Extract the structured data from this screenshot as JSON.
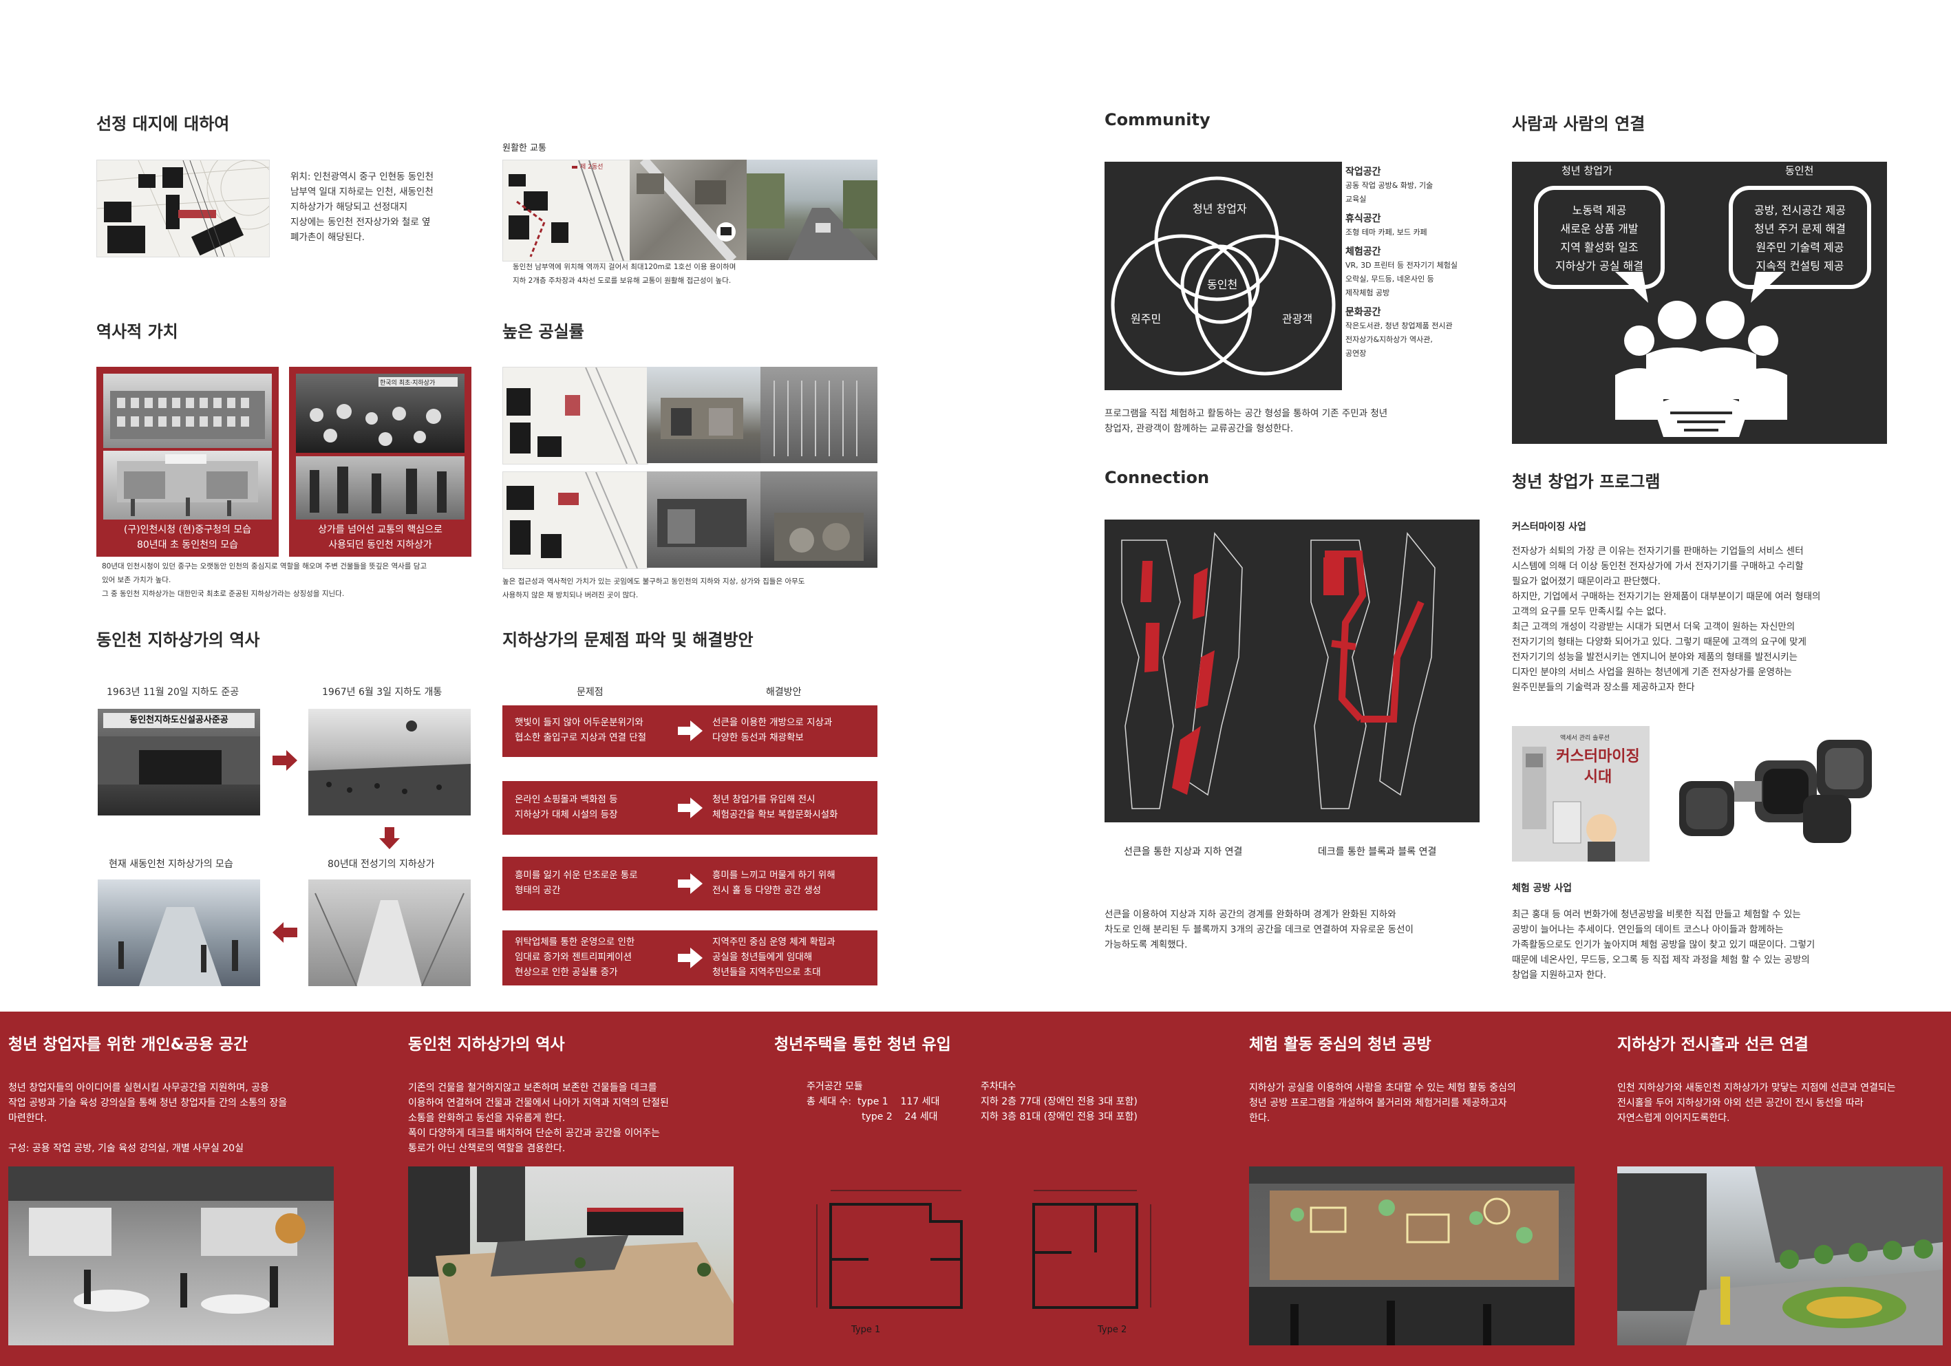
{
  "left": {
    "site": {
      "title": "선정 대지에 대하여",
      "text": "위치: 인천광역시 중구 인현동 동인천\n남부역 일대 지하로는 인천, 새동인천\n지하상가가 해당되고 선정대지\n지상에는 동인천 전자상가와 철로 옆\n폐가촌이 해당된다."
    },
    "traffic": {
      "label": "원활한 교통",
      "legend": "제 2동선",
      "text": "동인천 남부역에 위치해 역까지 걸어서 최대120m로 1호선 이용 용이하며\n지하 2개층 주차장과 4차선 도로를 보유해 교통이 원활해 접근성이 높다."
    },
    "history_value": {
      "title": "역사적 가치",
      "caption_left": "(구)인천시청 (현)중구청의 모습\n80년대 초 동인천의 모습",
      "caption_right": "상가를 넘어선 교통의 핵심으로\n사용되던 동인천 지하상가",
      "photo_sign": "한국의 최초·지하상가",
      "text": "80년대 인천시청이 있던 중구는 오랫동안 인천의 중심지로 역할을 해오며 주변 건물들을 뜻깊은 역사를 담고\n있어 보존 가치가 높다.\n그 중 동인천 지하상가는 대한민국 최초로 준공된 지하상가라는 상징성을 지닌다."
    },
    "vacancy": {
      "title": "높은 공실률",
      "text": "높은 접근성과 역사적인 가치가 있는 곳임에도 불구하고 동인천의 지하와 지상, 상가와 집들은 아무도\n사용하지 않은 채 방치되나 버려진 곳이 많다."
    },
    "mall_history": {
      "title": "동인천 지하상가의 역사",
      "labels": [
        "1963년 11월 20일 지하도 준공",
        "1967년 6월 3일 지하도 개통",
        "현재 새동인천 지하상가의 모습",
        "80년대 전성기의 지하상가"
      ],
      "photo_sign": "동인천지하도신설공사준공"
    },
    "problems": {
      "title": "지하상가의 문제점 파악 및 해결방안",
      "col_problem": "문제점",
      "col_solution": "해결방안",
      "rows": [
        {
          "problem": "햇빛이 들지 않아 어두운분위기와\n협소한 출입구로 지상과 연결 단절",
          "solution": "선큰을 이용한 개방으로 지상과\n다양한 동선과 채광확보"
        },
        {
          "problem": "온라인 쇼핑몰과 백화점 등\n지하상가 대체 시설의 등장",
          "solution": "청년 창업가를 유입해 전시\n체험공간을 확보 복합문화시설화"
        },
        {
          "problem": "흥미를 잃기 쉬운 단조로운 통로\n형태의 공간",
          "solution": "흥미를 느끼고 머물게 하기 위해\n전시 홀 등 다양한 공간 생성"
        },
        {
          "problem": "위탁업체를 통한 운영으로 인한\n임대료 증가와 젠트리피케이션\n현상으로 인한 공실률 증가",
          "solution": "지역주민 중심 운영 체계 확립과\n공실을 청년들에게 임대해\n청년들을 지역주민으로 초대"
        }
      ]
    }
  },
  "right": {
    "community": {
      "title": "Community",
      "circles": [
        "청년 창업자",
        "동인천",
        "원주민",
        "관광객"
      ],
      "spaces": [
        {
          "name": "작업공간",
          "desc": "공동 작업 공방& 화방, 기술\n교육실"
        },
        {
          "name": "휴식공간",
          "desc": "조형 테마 카페, 보드 카페"
        },
        {
          "name": "체험공간",
          "desc": "VR, 3D 프린터 등 전자기기 체험실\n오락실, 무드등, 네온사인 등\n제작체험 공방"
        },
        {
          "name": "문화공간",
          "desc": "작은도서관, 청년 창업제품 전시관\n전자상가&지하상가 역사관,\n공연장"
        }
      ],
      "text": "프로그램을 직접 체험하고 활동하는 공간 형성을 통하여 기존 주민과 청년\n창업자, 관광객이 함께하는 교류공간을 형성한다."
    },
    "people": {
      "title": "사람과 사람의 연결",
      "left_head": "청년 창업가",
      "right_head": "동인천",
      "left_bubble": "노동력 제공\n새로운 상품 개발\n지역 활성화 일조\n지하상가 공실 해결",
      "right_bubble": "공방, 전시공간 제공\n청년 주거 문제 해결\n원주민 기술력 제공\n지속적 컨설팅 제공"
    },
    "connection": {
      "title": "Connection",
      "caption_left": "선큰을 통한 지상과 지하 연결",
      "caption_right": "데크를 통한 블록과 블록 연결",
      "text": "선큰을 이용하여 지상과 지하 공간의 경계를 완화하며 경계가 완화된 지하와\n차도로 인해 분리된 두 블록까지 3개의 공간을 데크로 연결하여 자유로운 동선이\n가능하도록 계획했다."
    },
    "program": {
      "title": "청년 창업가 프로그램",
      "sub1": "커스터마이징 사업",
      "text1": "전자상가 쇠퇴의 가장 큰 이유는 전자기기를 판매하는 기업들의 서비스 센터\n시스템에 의해 더 이상 동인천 전자상가에 가서 전자기기를 구매하고 수리할\n필요가 없어졌기 때문이라고 판단했다.\n하지만, 기업에서 구매하는 전자기기는 완제품이 대부분이기 때문에 여러 형태의\n고객의 요구를 모두 만족시킬 수는 없다.\n최근 고객의 개성이 각광받는 시대가 되면서 더욱 고객이 원하는 자신만의\n전자기기의 형태는 다양화 되어가고 있다. 그렇기 때문에 고객의 요구에 맞게\n전자기기의 성능을 발전시키는 엔지니어 분야와 제품의 형태를 발전시키는\n디자인 분야의 서비스 사업을 원하는 청년에게 기존 전자상가를 운영하는\n원주민분들의 기술력과 장소를 제공하고자 한다",
      "poster_small": "액세서 관리 솔루션",
      "poster_big": "커스터마이징\n시대",
      "sub2": "체험 공방 사업",
      "text2": "최근 홍대 등 여러 번화가에 청년공방을 비롯한 직접 만들고 체험할 수 있는\n공방이 늘어나는 추세이다. 연인들의 데이트 코스나 아이들과 함께하는\n가족활동으로도 인기가 높아지며 체험 공방을 많이 찾고 있기 때문이다. 그렇기\n때문에 네온사인, 무드등, 오그록 등 직접 제작 과정을 체험 할 수 있는 공방의\n창업을 지원하고자 한다."
    }
  },
  "bottom": [
    {
      "title": "청년 창업자를 위한 개인&공용 공간",
      "text": "청년 창업자들의 아이디어를 실현시킬 사무공간을 지원하며, 공용\n작업 공방과 기술 육성 강의실을 통해 청년 창업자들 간의 소통의 장을\n마련한다.\n\n구성: 공용 작업 공방, 기술 육성 강의실, 개별 사무실 20실"
    },
    {
      "title": "동인천 지하상가의 역사",
      "text": "기존의 건물을 철거하지않고 보존하며 보존한 건물들을 데크를\n이용하여 연결하여 건물과 건물에서 나아가 지역과 지역의 단절된\n소통을 완화하고 동선을 자유롭게 한다.\n폭이 다양하게 데크를 배치하여 단순히 공간과 공간을 이어주는\n통로가 아닌 산책로의 역할을 겸용한다."
    },
    {
      "title": "청년주택을 통한 청년 유입",
      "housing_head": "주거공간 모듈",
      "housing_rows": "총 세대 수:  type 1    117 세대\n                  type 2    24 세대",
      "parking_head": "주차대수",
      "parking_rows": "지하 2층 77대 (장애인 전용 3대 포함)\n지하 3층 81대 (장애인 전용 3대 포함)",
      "type1": "Type 1",
      "type2": "Type 2"
    },
    {
      "title": "체험 활동 중심의 청년 공방",
      "text": "지하상가 공실을 이용하여 사람을 초대할 수 있는 체험 활동 중심의\n청년 공방 프로그램을 개설하여 볼거리와 체험거리를 제공하고자\n한다."
    },
    {
      "title": "지하상가 전시홀과 선큰 연결",
      "text": "인천 지하상가와 새동인천 지하상가가 맞닿는 지점에 선큰과 연결되는\n전시홀을 두어 지하상가와 야외 선큰 공간이 전시 동선을 따라\n자연스럽게 이어지도록한다."
    }
  ],
  "colors": {
    "brand_red": "#a0262c",
    "dark_panel": "#2b2b2b"
  }
}
